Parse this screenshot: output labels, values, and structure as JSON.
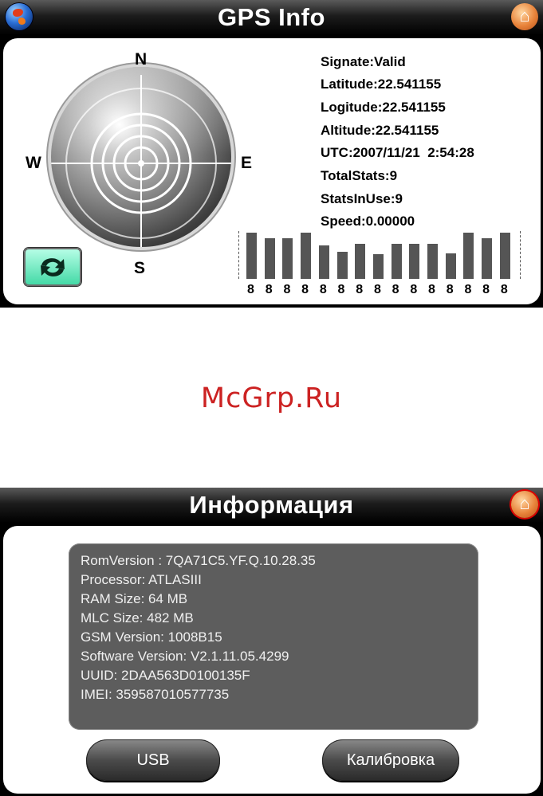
{
  "gps": {
    "title": "GPS Info",
    "compass": {
      "n": "N",
      "e": "E",
      "s": "S",
      "w": "W"
    },
    "lines": [
      "Signate:Valid",
      "Latitude:22.541155",
      "Logitude:22.541155",
      "Altitude:22.541155",
      "UTC:2007/11/21  2:54:28",
      "TotalStats:9",
      "StatsInUse:9",
      "Speed:0.00000"
    ],
    "satellite_bars": {
      "labels": [
        "8",
        "8",
        "8",
        "8",
        "8",
        "8",
        "8",
        "8",
        "8",
        "8",
        "8",
        "8",
        "8",
        "8",
        "8"
      ],
      "levels": [
        1.0,
        0.88,
        0.88,
        1.0,
        0.72,
        0.58,
        0.76,
        0.54,
        0.76,
        0.76,
        0.76,
        0.55,
        1.0,
        0.88,
        1.0
      ]
    },
    "icons": {
      "globe": "globe-icon",
      "home": "home-icon",
      "refresh": "refresh-icon"
    }
  },
  "watermark": "McGrp.Ru",
  "info": {
    "title": "Информация",
    "lines": [
      "RomVersion : 7QA71C5.YF.Q.10.28.35",
      "Processor: ATLASIII",
      "RAM Size: 64 MB",
      "MLC Size: 482 MB",
      "GSM Version: 1008B15",
      "Software Version: V2.1.11.05.4299",
      "UUID: 2DAA563D0100135F",
      "IMEI: 359587010577735"
    ],
    "usb_button": "USB",
    "calib_button": "Калибровка"
  },
  "colors": {
    "accent_green": "#3fd8a4",
    "watermark": "#cc2222",
    "home_orange": "#e8833a"
  }
}
